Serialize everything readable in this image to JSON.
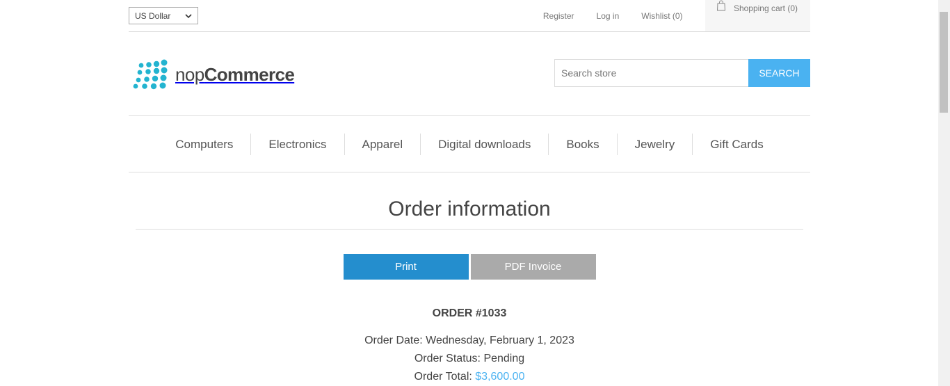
{
  "header": {
    "currency": "US Dollar",
    "links": {
      "register": "Register",
      "login": "Log in",
      "wishlist": "Wishlist (0)",
      "cart": "Shopping cart (0)"
    },
    "logo": {
      "prefix": "nop",
      "suffix": "Commerce"
    },
    "search": {
      "placeholder": "Search store",
      "button": "SEARCH"
    }
  },
  "menu": {
    "items": [
      "Computers",
      "Electronics",
      "Apparel",
      "Digital downloads",
      "Books",
      "Jewelry",
      "Gift Cards"
    ]
  },
  "main": {
    "title": "Order information",
    "print_label": "Print",
    "pdf_label": "PDF Invoice",
    "order_number": "ORDER #1033",
    "date_label": "Order Date:",
    "date_value": "Wednesday, February 1, 2023",
    "status_label": "Order Status:",
    "status_value": "Pending",
    "total_label": "Order Total:",
    "total_value": "$3,600.00"
  },
  "colors": {
    "accent": "#4ab2f1",
    "print_button": "#248ece",
    "pdf_button": "#aaaaaa"
  },
  "icons": {
    "currency_dropdown": "chevron-down-icon",
    "cart": "shopping-bag-icon",
    "logo": "nopcommerce-dots-logo"
  }
}
